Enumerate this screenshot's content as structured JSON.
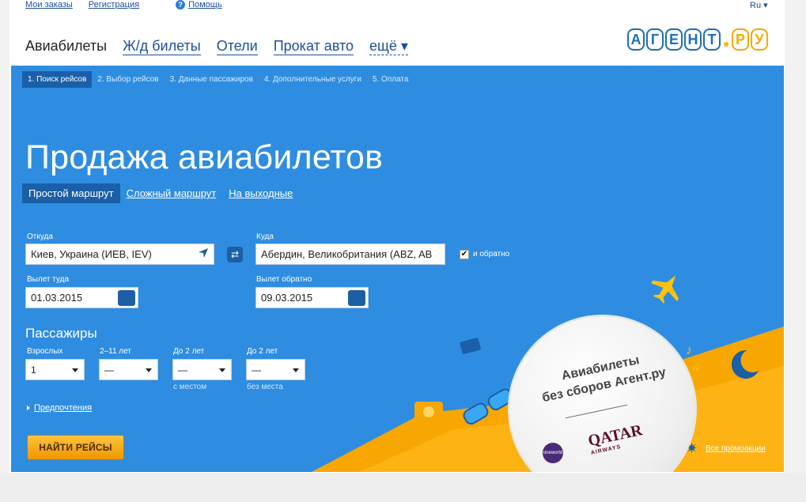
{
  "toplinks": {
    "orders": "Мои заказы",
    "register": "Регистрация",
    "help": "Помощь",
    "lang": "Ru ▾"
  },
  "nav": {
    "items": [
      "Авиабилеты",
      "Ж/д билеты",
      "Отели",
      "Прокат авто"
    ],
    "more": "ещё ▾"
  },
  "logo": {
    "letters": [
      "А",
      "Г",
      "Е",
      "Н",
      "Т",
      "Р",
      "У"
    ]
  },
  "steps": [
    "1. Поиск рейсов",
    "2. Выбор рейсов",
    "3. Данные пассажиров",
    "4. Дополнительные услуги",
    "5. Оплата"
  ],
  "hero": {
    "title": "Продажа авиабилетов",
    "routes": [
      "Простой маршрут",
      "Сложный маршрут",
      "На выходные"
    ]
  },
  "form": {
    "from_label": "Откуда",
    "from_value": "Киев, Украина (ИЕВ, IEV)",
    "to_label": "Куда",
    "to_value": "Абердин, Великобритания (ABZ, AB",
    "roundtrip_label": "и обратно",
    "roundtrip_checked": "✔",
    "depart_label": "Вылет туда",
    "depart_value": "01.03.2015",
    "return_label": "Вылет обратно",
    "return_value": "09.03.2015",
    "passengers_title": "Пассажиры",
    "adults_label": "Взрослых",
    "adults_value": "1",
    "children_label": "2–11 лет",
    "children_value": "—",
    "infant_seat_label": "До 2 лет",
    "infant_seat_value": "—",
    "infant_seat_sub": "с местом",
    "infant_noseat_label": "До 2 лет",
    "infant_noseat_value": "—",
    "infant_noseat_sub": "без места",
    "preferences": "Предпочтения",
    "search_button": "НАЙТИ РЕЙСЫ"
  },
  "promo": {
    "line1": "Авиабилеты",
    "line2": "без сборов Агент.ру",
    "airline": "QATAR",
    "airline_sub": "AIRWAYS",
    "alliance": "oneworld",
    "all_promos": "Все промоакции"
  },
  "colors": {
    "hero_bg": "#2e8de0",
    "accent_dark": "#1a5fa8",
    "orange": "#f5a800",
    "link": "#1a4f9c"
  }
}
